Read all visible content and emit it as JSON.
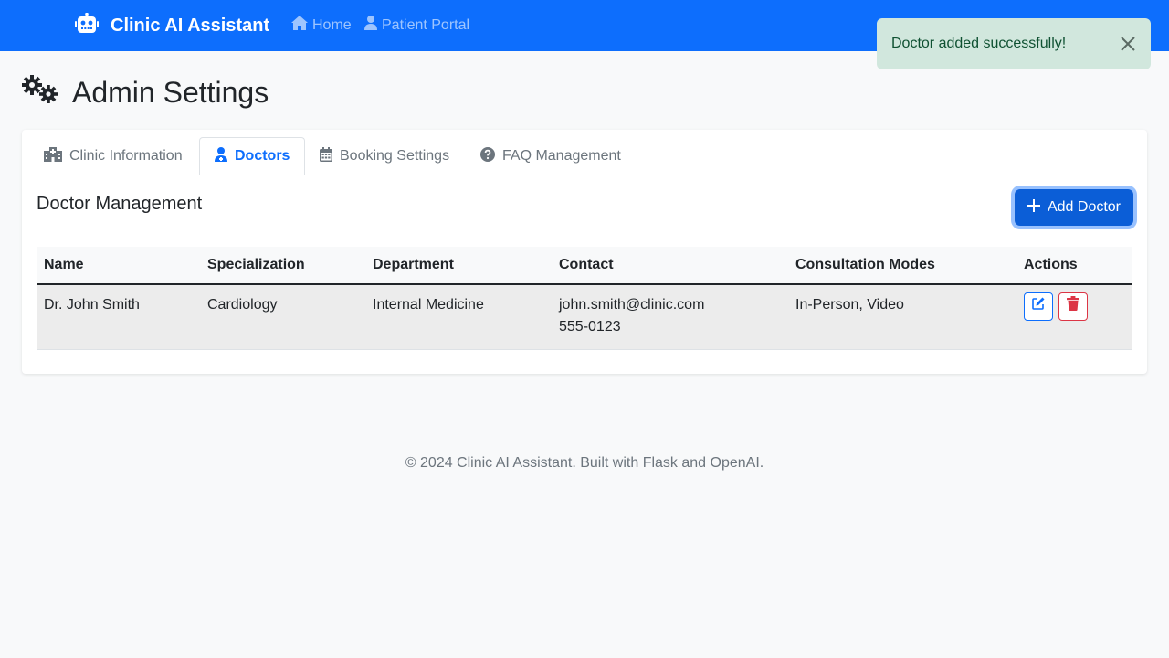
{
  "navbar": {
    "brand": "Clinic AI Assistant",
    "links": [
      {
        "label": "Home",
        "icon": "home-icon"
      },
      {
        "label": "Patient Portal",
        "icon": "user-icon"
      }
    ],
    "color": "#0d6efd"
  },
  "toast": {
    "message": "Doctor added successfully!",
    "color": "#d1e7dd"
  },
  "page": {
    "title": "Admin Settings",
    "icon": "cogs-icon"
  },
  "tabs": [
    {
      "label": "Clinic Information",
      "icon": "hospital-icon",
      "active": false
    },
    {
      "label": "Doctors",
      "icon": "user-doctor-icon",
      "active": true
    },
    {
      "label": "Booking Settings",
      "icon": "calendar-icon",
      "active": false
    },
    {
      "label": "FAQ Management",
      "icon": "question-circle-icon",
      "active": false
    }
  ],
  "doctors": {
    "section_title": "Doctor Management",
    "add_label": "Add Doctor",
    "columns": [
      "Name",
      "Specialization",
      "Department",
      "Contact",
      "Consultation Modes",
      "Actions"
    ],
    "rows": [
      {
        "name": "Dr. John Smith",
        "specialization": "Cardiology",
        "department": "Internal Medicine",
        "email": "john.smith@clinic.com",
        "phone": "555-0123",
        "modes": "In-Person, Video"
      }
    ]
  },
  "footer": {
    "text": "© 2024 Clinic AI Assistant. Built with Flask and OpenAI."
  }
}
